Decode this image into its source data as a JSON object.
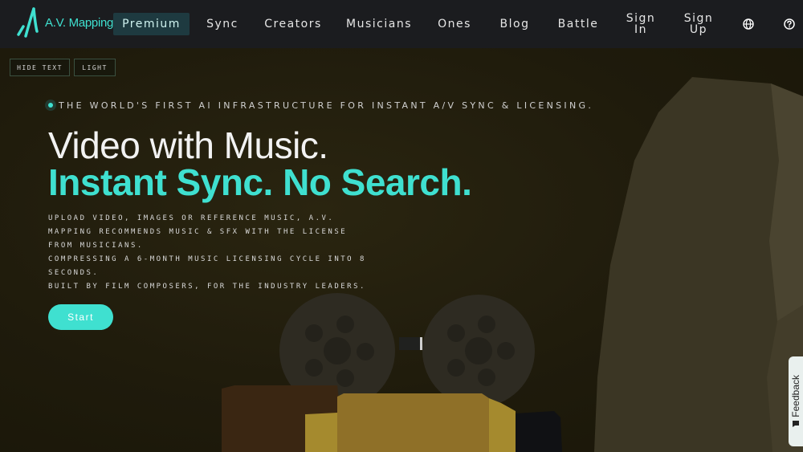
{
  "nav": {
    "brand": "A.V. Mapping",
    "items": [
      {
        "label": "Premium"
      },
      {
        "label": "Sync"
      },
      {
        "label": "Creators"
      },
      {
        "label": "Musicians"
      },
      {
        "label": "Ones"
      },
      {
        "label": "Blog"
      },
      {
        "label": "Battle"
      },
      {
        "label": "Sign\nIn"
      },
      {
        "label": "Sign\nUp"
      }
    ],
    "icons": [
      "globe-icon",
      "help-icon"
    ]
  },
  "toggles": {
    "hide_text": "HIDE TEXT",
    "light": "LIGHT"
  },
  "hero": {
    "tagline": "THE WORLD'S FIRST AI INFRASTRUCTURE FOR INSTANT A/V SYNC & LICENSING.",
    "title_line1": "Video with Music.",
    "title_line2": "Instant Sync. No Search.",
    "description": [
      "UPLOAD VIDEO, IMAGES OR REFERENCE MUSIC, A.V.",
      "MAPPING RECOMMENDS MUSIC & SFX WITH THE LICENSE",
      "FROM MUSICIANS.",
      "COMPRESSING A 6-MONTH MUSIC LICENSING CYCLE INTO 8",
      "SECONDS.",
      "BUILT BY FILM COMPOSERS, FOR THE INDUSTRY LEADERS."
    ],
    "start_label": "Start"
  },
  "feedback": {
    "label": "Feedback"
  },
  "colors": {
    "accent": "#3fe0d0",
    "nav_bg": "#1b1c1f",
    "scene_bg": "#1f1b0c"
  }
}
